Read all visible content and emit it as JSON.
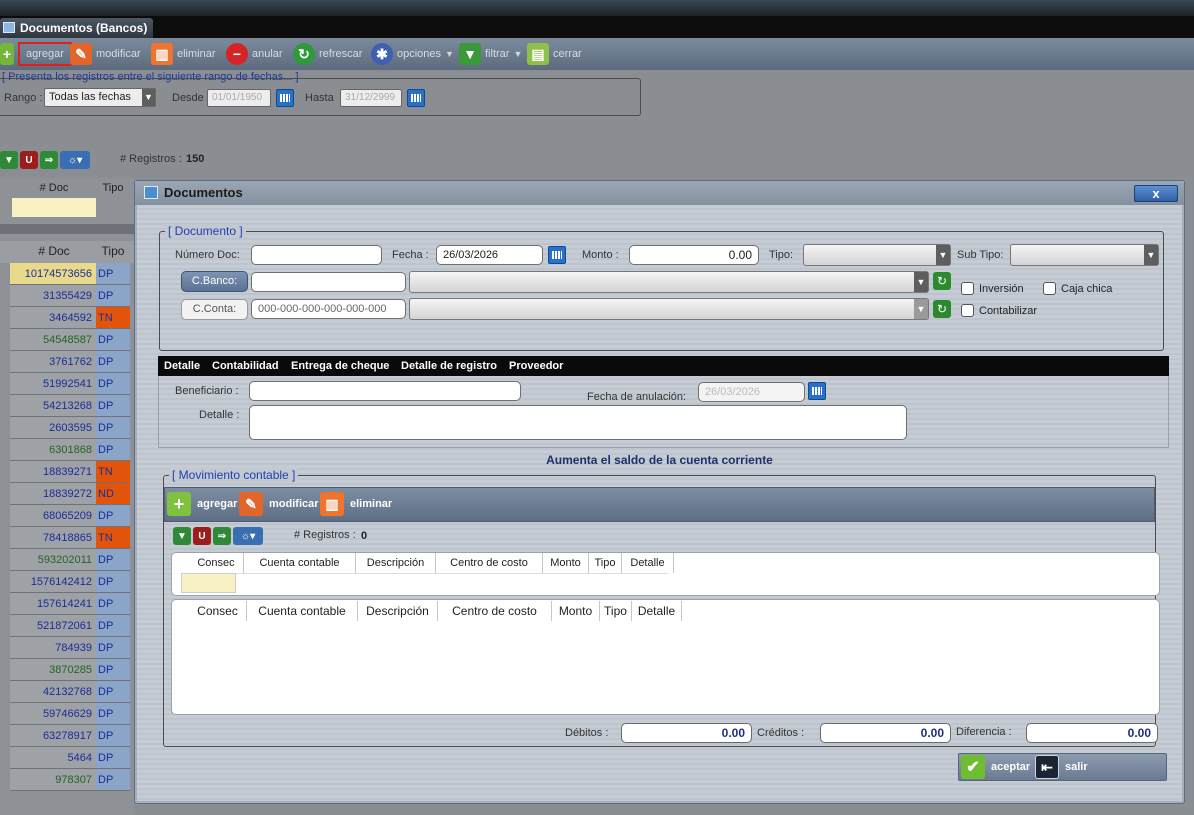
{
  "window": {
    "tab_title": "Documentos (Bancos)"
  },
  "toolbar": [
    {
      "label": "agregar",
      "icon": "add-icon"
    },
    {
      "label": "modificar",
      "icon": "pencil-icon"
    },
    {
      "label": "eliminar",
      "icon": "trash-icon"
    },
    {
      "label": "anular",
      "icon": "cancel-icon"
    },
    {
      "label": "refrescar",
      "icon": "refresh-icon"
    },
    {
      "label": "opciones",
      "icon": "options-icon"
    },
    {
      "label": "filtrar",
      "icon": "filter-icon"
    },
    {
      "label": "cerrar",
      "icon": "close-doc-icon"
    }
  ],
  "range": {
    "legend": "[ Presenta los registros entre el siguiente rango de fechas... ]",
    "rango_label": "Rango :",
    "rango_value": "Todas las fechas",
    "desde_label": "Desde",
    "desde_value": "01/01/1950",
    "hasta_label": "Hasta",
    "hasta_value": "31/12/2999"
  },
  "grid": {
    "registros_label": "# Registros :",
    "registros_count": "150",
    "col_doc": "# Doc",
    "col_tipo": "Tipo",
    "rows": [
      {
        "doc": "10174573656",
        "tipo": "DP"
      },
      {
        "doc": "31355429",
        "tipo": "DP"
      },
      {
        "doc": "3464592",
        "tipo": "TN"
      },
      {
        "doc": "54548587",
        "tipo": "DP"
      },
      {
        "doc": "3761762",
        "tipo": "DP"
      },
      {
        "doc": "51992541",
        "tipo": "DP"
      },
      {
        "doc": "54213268",
        "tipo": "DP"
      },
      {
        "doc": "2603595",
        "tipo": "DP"
      },
      {
        "doc": "6301868",
        "tipo": "DP"
      },
      {
        "doc": "18839271",
        "tipo": "TN"
      },
      {
        "doc": "18839272",
        "tipo": "ND"
      },
      {
        "doc": "68065209",
        "tipo": "DP"
      },
      {
        "doc": "78418865",
        "tipo": "TN"
      },
      {
        "doc": "593202011",
        "tipo": "DP"
      },
      {
        "doc": "1576142412",
        "tipo": "DP"
      },
      {
        "doc": "157614241",
        "tipo": "DP"
      },
      {
        "doc": "521872061",
        "tipo": "DP"
      },
      {
        "doc": "784939",
        "tipo": "DP"
      },
      {
        "doc": "3870285",
        "tipo": "DP"
      },
      {
        "doc": "42132768",
        "tipo": "DP"
      },
      {
        "doc": "59746629",
        "tipo": "DP"
      },
      {
        "doc": "63278917",
        "tipo": "DP"
      },
      {
        "doc": "5464",
        "tipo": "DP"
      },
      {
        "doc": "978307",
        "tipo": "DP"
      }
    ]
  },
  "dialog": {
    "title": "Documentos",
    "close": "x",
    "doc_legend": "[ Documento ]",
    "numero_label": "Número Doc:",
    "numero_value": "",
    "fecha_label": "Fecha :",
    "fecha_value": "26/03/2026",
    "monto_label": "Monto :",
    "monto_value": "0.00",
    "tipo_label": "Tipo:",
    "subtipo_label": "Sub Tipo:",
    "cbanco_label": "C.Banco:",
    "cconta_label": "C.Conta:",
    "cconta_placeholder": "000-000-000-000-000-000",
    "inversion_label": "Inversión",
    "cajachica_label": "Caja chica",
    "contabilizar_label": "Contabilizar",
    "tabs": [
      "Detalle",
      "Contabilidad",
      "Entrega de cheque",
      "Detalle de registro",
      "Proveedor"
    ],
    "beneficiario_label": "Beneficiario :",
    "anulacion_label": "Fecha de anulación:",
    "anulacion_value": "26/03/2026",
    "detalle_label": "Detalle :",
    "info_text": "Aumenta el saldo de la cuenta corriente",
    "mov_legend": "[ Movimiento contable ]",
    "mov_buttons": [
      "agregar",
      "modificar",
      "eliminar"
    ],
    "mov_registros_label": "# Registros :",
    "mov_registros_count": "0",
    "columns": [
      "Consec",
      "Cuenta contable",
      "Descripción",
      "Centro de costo",
      "Monto",
      "Tipo",
      "Detalle"
    ],
    "debitos_label": "Débitos :",
    "debitos_value": "0.00",
    "creditos_label": "Créditos :",
    "creditos_value": "0.00",
    "diferencia_label": "Diferencia :",
    "diferencia_value": "0.00",
    "aceptar_label": "aceptar",
    "salir_label": "salir"
  },
  "colors": {
    "tipo_DP": "#8aa5c8",
    "tipo_TN": "#e2540c",
    "tipo_ND": "#e2540c",
    "legend": "#1f3fb5"
  }
}
